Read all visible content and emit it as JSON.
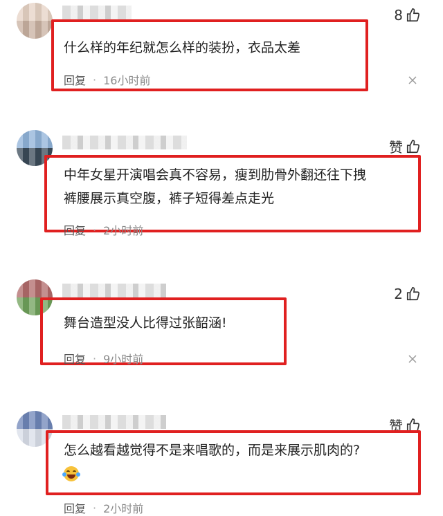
{
  "comments": [
    {
      "likes": "8",
      "text": "什么样的年纪就怎么样的装扮，衣品太差",
      "reply_label": "回复",
      "time": "16小时前",
      "avatar_colors": [
        "#e6d2c4",
        "#c8b0a0"
      ]
    },
    {
      "likes": "赞",
      "text": "中年女星开演唱会真不容易，瘦到肋骨外翻还往下拽\n裤腰展示真空腹，裤子短得差点走光",
      "reply_label": "回复",
      "time": "2小时前",
      "avatar_colors": [
        "#8fb2d8",
        "#3a4a58"
      ]
    },
    {
      "likes": "2",
      "text": "舞台造型没人比得过张韶涵!",
      "reply_label": "回复",
      "time": "9小时前",
      "avatar_colors": [
        "#b06a6a",
        "#6fa05a"
      ]
    },
    {
      "likes": "赞",
      "text": "怎么越看越觉得不是来唱歌的，而是来展示肌肉的?",
      "reply_label": "回复",
      "time": "2小时前",
      "avatar_colors": [
        "#6f86b8",
        "#d8dde8"
      ]
    }
  ],
  "separator": "·",
  "icons": {
    "like": "thumbs-up-icon",
    "more": "close-icon",
    "emoji": "laughing-tears-emoji"
  },
  "colors": {
    "highlight": "#e02020"
  }
}
